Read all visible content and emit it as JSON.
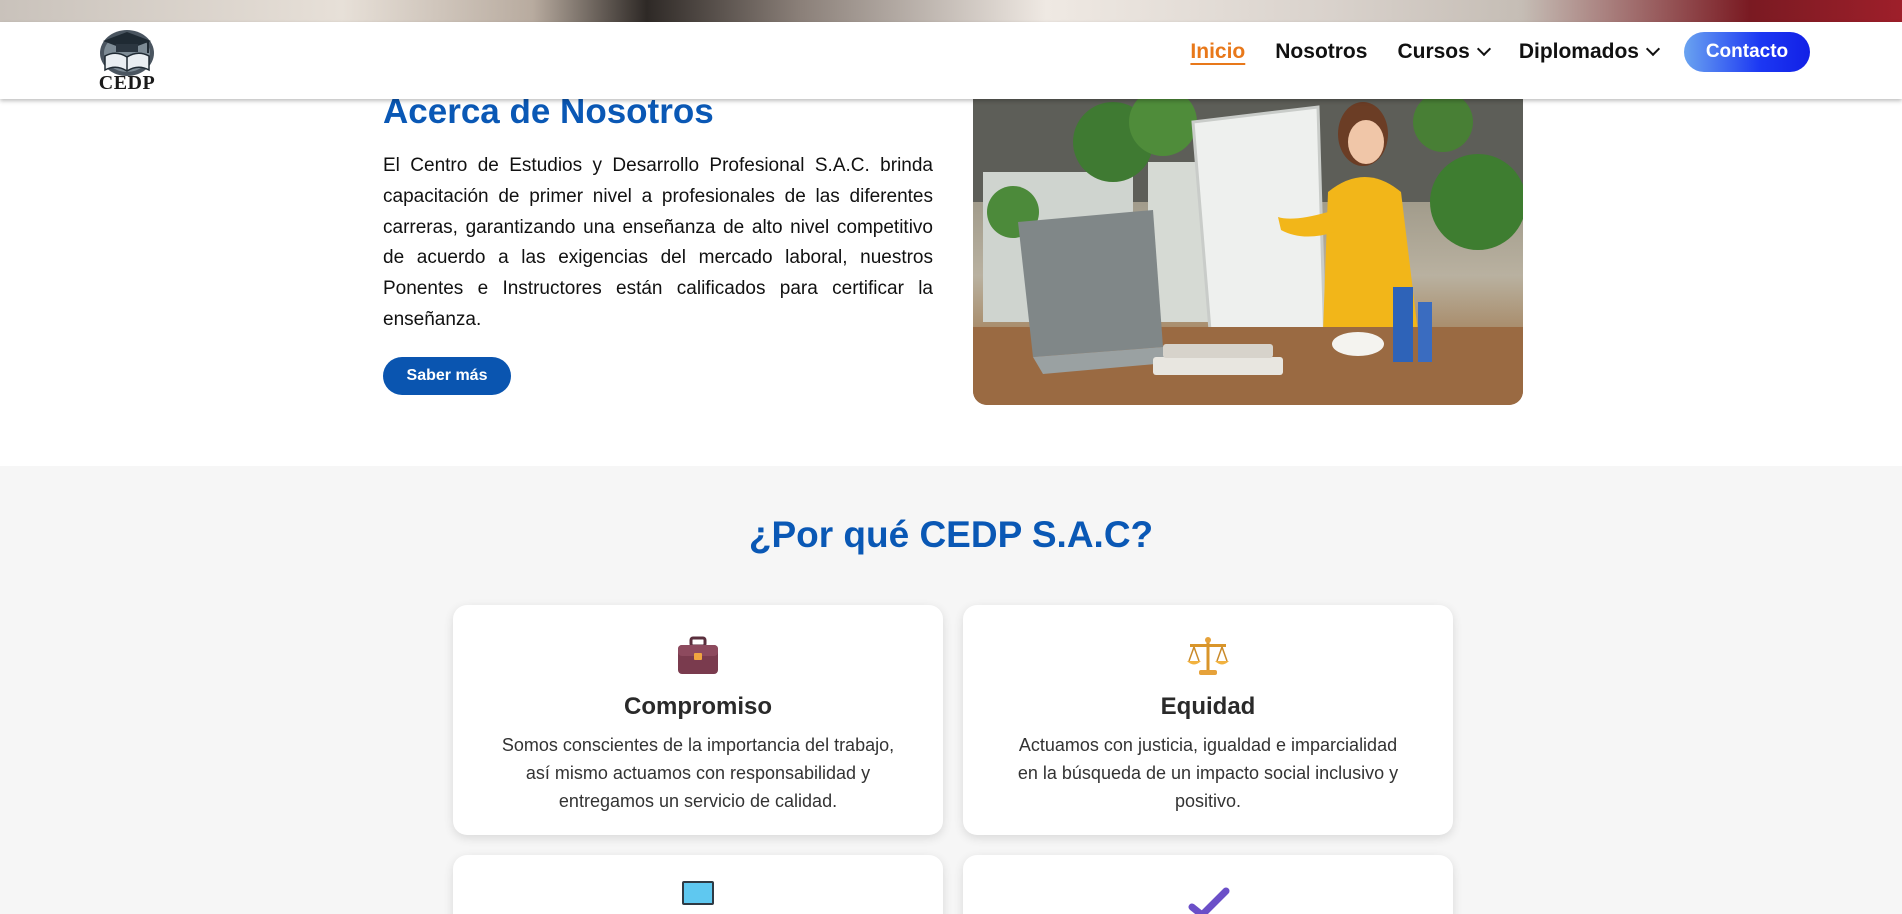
{
  "header": {
    "logo_text": "CEDP",
    "nav": {
      "inicio": "Inicio",
      "nosotros": "Nosotros",
      "cursos": "Cursos",
      "diplomados": "Diplomados",
      "contacto": "Contacto"
    },
    "active_item": "Inicio"
  },
  "about": {
    "title": "Acerca de Nosotros",
    "text": "El Centro de Estudios y Desarrollo Profesional S.A.C. brinda capacitación de primer nivel a profesionales de las diferentes carreras, garantizando una enseñanza de alto nivel competitivo de acuerdo a las exigencias del mercado laboral, nuestros Ponentes e Instructores están calificados para certificar la enseñanza.",
    "button": "Saber más"
  },
  "why": {
    "title": "¿Por qué CEDP S.A.C?",
    "cards": [
      {
        "icon": "briefcase-icon",
        "title": "Compromiso",
        "text": "Somos conscientes de la importancia del trabajo, así mismo actuamos con responsabilidad y entregamos un servicio de calidad."
      },
      {
        "icon": "balance-scale-icon",
        "title": "Equidad",
        "text": "Actuamos con justicia, igualdad e imparcialidad en la búsqueda de un impacto social inclusivo y positivo."
      },
      {
        "icon": "laptop-icon"
      },
      {
        "icon": "check-mark-icon"
      }
    ]
  },
  "colors": {
    "primary_blue": "#0a58b5",
    "active_nav": "#e8781a",
    "section_bg": "#f6f6f6"
  }
}
